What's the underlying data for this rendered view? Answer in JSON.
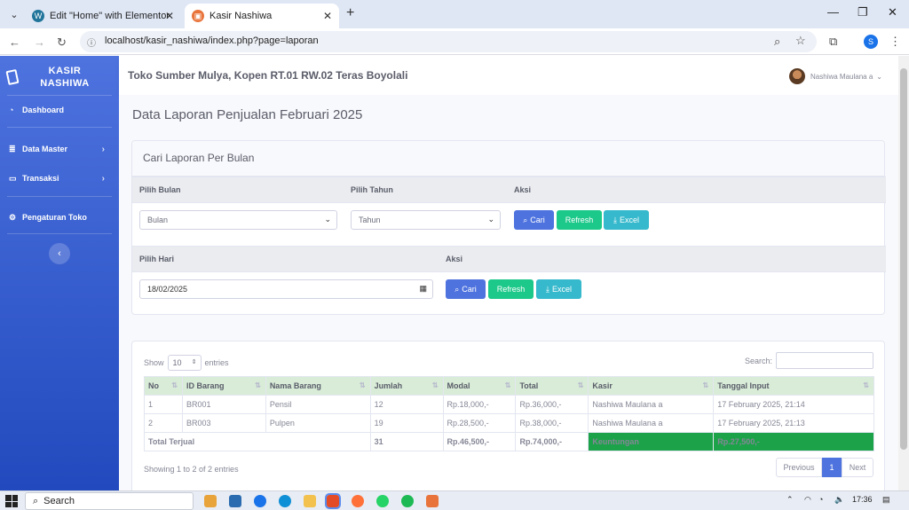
{
  "browser": {
    "tabs": [
      {
        "title": "Edit \"Home\" with Elementor",
        "icon": "wordpress-icon"
      },
      {
        "title": "Kasir Nashiwa",
        "icon": "kasir-app-icon"
      }
    ],
    "url": "localhost/kasir_nashiwa/index.php?page=laporan",
    "profile_initial": "S"
  },
  "sidebar": {
    "brand_line1": "KASIR",
    "brand_line2": "NASHIWA",
    "items": [
      {
        "label": "Dashboard",
        "icon": "tachometer-icon"
      },
      {
        "label": "Data Master",
        "icon": "database-icon"
      },
      {
        "label": "Transaksi",
        "icon": "desktop-icon"
      },
      {
        "label": "Pengaturan Toko",
        "icon": "cogs-icon"
      }
    ]
  },
  "topbar": {
    "store": "Toko Sumber Mulya, Kopen RT.01 RW.02 Teras Boyolali",
    "user": "Nashiwa Maulana a"
  },
  "page": {
    "title": "Data Laporan Penjualan Februari 2025",
    "filter_card_title": "Cari Laporan Per Bulan",
    "label_bulan": "Pilih Bulan",
    "label_tahun": "Pilih Tahun",
    "label_aksi": "Aksi",
    "select_bulan": "Bulan",
    "select_tahun": "Tahun",
    "label_hari": "Pilih Hari",
    "date_value": "18/02/2025",
    "btn_cari": "Cari",
    "btn_refresh": "Refresh",
    "btn_excel": "Excel"
  },
  "table": {
    "show": "Show",
    "length": "10",
    "entries": "entries",
    "search_label": "Search:",
    "columns": [
      "No",
      "ID Barang",
      "Nama Barang",
      "Jumlah",
      "Modal",
      "Total",
      "Kasir",
      "Tanggal Input"
    ],
    "rows": [
      [
        "1",
        "BR001",
        "Pensil",
        "12",
        "Rp.18,000,-",
        "Rp.36,000,-",
        "Nashiwa Maulana a",
        "17 February 2025, 21:14"
      ],
      [
        "2",
        "BR003",
        "Pulpen",
        "19",
        "Rp.28,500,-",
        "Rp.38,000,-",
        "Nashiwa Maulana a",
        "17 February 2025, 21:13"
      ]
    ],
    "footer": {
      "label": "Total Terjual",
      "jumlah": "31",
      "modal": "Rp.46,500,-",
      "total": "Rp.74,000,-",
      "keuntungan_label": "Keuntungan",
      "keuntungan": "Rp.27,500,-"
    },
    "info": "Showing 1 to 2 of 2 entries",
    "pager": {
      "prev": "Previous",
      "page": "1",
      "next": "Next"
    }
  },
  "taskbar": {
    "search": "Search",
    "time": "17:36"
  }
}
